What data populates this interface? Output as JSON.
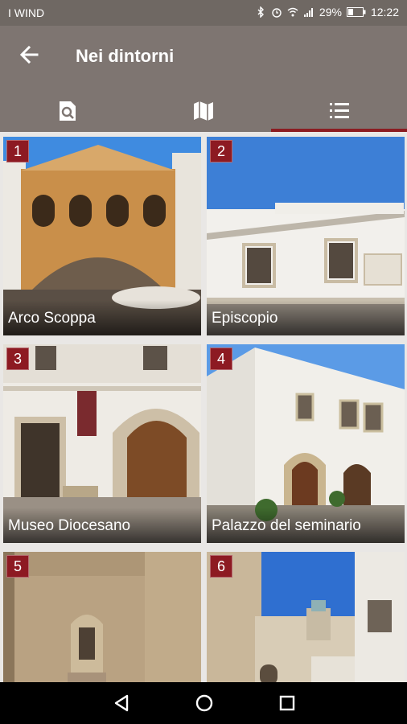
{
  "status_bar": {
    "carrier": "I WIND",
    "battery": "29%",
    "time": "12:22"
  },
  "app_bar": {
    "title": "Nei dintorni"
  },
  "tabs": [
    {
      "icon": "search-list-icon",
      "active": false
    },
    {
      "icon": "map-icon",
      "active": false
    },
    {
      "icon": "list-icon",
      "active": true
    }
  ],
  "places": [
    {
      "number": "1",
      "name": "Arco Scoppa"
    },
    {
      "number": "2",
      "name": "Episcopio"
    },
    {
      "number": "3",
      "name": "Museo Diocesano"
    },
    {
      "number": "4",
      "name": "Palazzo del seminario"
    },
    {
      "number": "5",
      "name": ""
    },
    {
      "number": "6",
      "name": ""
    }
  ],
  "colors": {
    "status_bar": "#6f6863",
    "app_bar": "#7e7571",
    "accent": "#8b1c21",
    "badge": "#8d1a22"
  }
}
